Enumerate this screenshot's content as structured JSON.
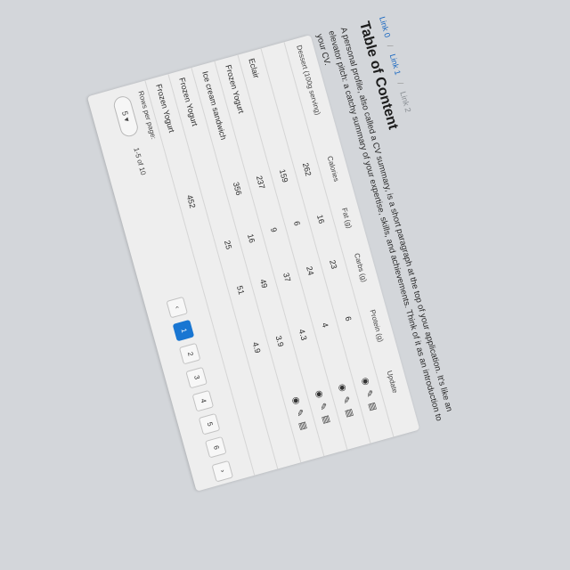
{
  "breadcrumb": {
    "items": [
      "Link 0",
      "Link 1",
      "Link 2"
    ],
    "separator": "/"
  },
  "title": "Table of Content",
  "intro": "A personal profile, also called a CV summary, is a short paragraph at the top of your application. It's like an elevator pitch: a catchy summary of your expertise, skills, and achievements. Think of it as an introduction to your CV.",
  "table": {
    "headers": [
      "Dessert (100g serving)",
      "Calories",
      "Fat (g)",
      "Carbs (g)",
      "Protein (g)",
      "Update"
    ],
    "rows": [
      [
        "",
        "262",
        "16",
        "23",
        "6"
      ],
      [
        "Eclair",
        "159",
        "6",
        "24",
        "4"
      ],
      [
        "Frozen Yogurt",
        "237",
        "9",
        "37",
        "4.3"
      ],
      [
        "Ice cream sandwich",
        "356",
        "16",
        "49",
        "3.9"
      ],
      [
        "Frozen Yogurt",
        "",
        "25",
        "51",
        "4.9"
      ],
      [
        "Frozen Yogurt",
        "452",
        "",
        "",
        ""
      ]
    ],
    "row_actions": [
      "view-icon",
      "edit-icon",
      "delete-icon"
    ]
  },
  "footer": {
    "rows_per_page_label": "Rows per page:",
    "rows_per_page_value": "5",
    "range_label": "1-5 of 10",
    "pages": [
      "1",
      "2",
      "3",
      "4",
      "5",
      "6"
    ],
    "active_page": "1",
    "prev_label": "‹",
    "next_label": "›"
  },
  "colors": {
    "accent": "#1976d2",
    "link": "#1565c0",
    "background": "#d3d6da"
  }
}
